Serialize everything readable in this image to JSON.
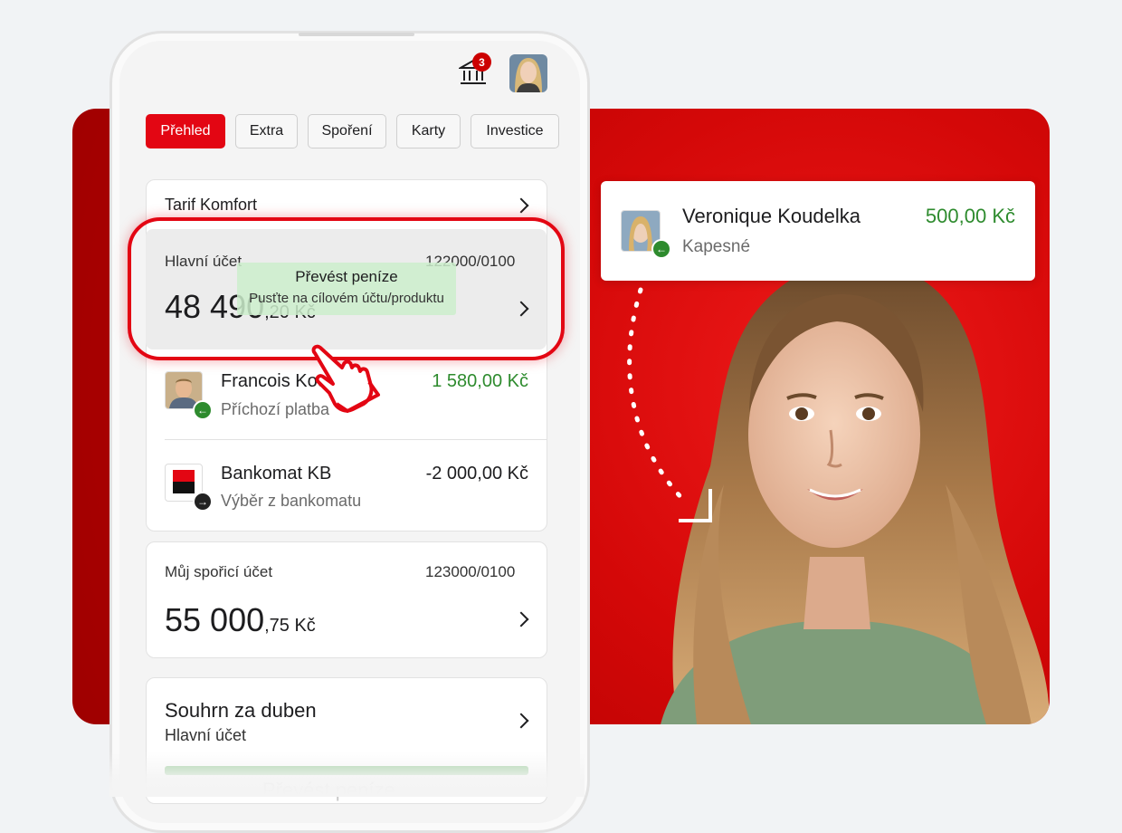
{
  "header": {
    "notification_count": "3"
  },
  "tabs": [
    {
      "label": "Přehled",
      "active": true
    },
    {
      "label": "Extra"
    },
    {
      "label": "Spoření"
    },
    {
      "label": "Karty"
    },
    {
      "label": "Investice"
    }
  ],
  "tarif": {
    "label": "Tarif Komfort"
  },
  "main_account": {
    "name": "Hlavní účet",
    "number": "122000/0100",
    "amount_int": "48 490",
    "amount_dec": ",20 Kč"
  },
  "drag_hint": {
    "title": "Převést peníze",
    "subtitle": "Pusťte na cílovém účtu/produktu"
  },
  "transactions": [
    {
      "name": "Francois Kou",
      "sub": "Příchozí platba",
      "amount": "1 580,00 Kč",
      "direction": "incoming"
    },
    {
      "name": "Bankomat KB",
      "sub": "Výběr z bankomatu",
      "amount": "-2 000,00 Kč",
      "direction": "outgoing"
    }
  ],
  "savings": {
    "name": "Můj spořicí účet",
    "number": "123000/0100",
    "amount_int": "55 000",
    "amount_dec": ",75 Kč"
  },
  "summary": {
    "title": "Souhrn za duben",
    "subtitle": "Hlavní účet"
  },
  "ghost_text": "Převést peníze",
  "notification_card": {
    "name": "Veronique Koudelka",
    "sub": "Kapesné",
    "amount": "500,00 Kč"
  },
  "colors": {
    "brand_red": "#e30613",
    "positive": "#2e8b2e"
  }
}
